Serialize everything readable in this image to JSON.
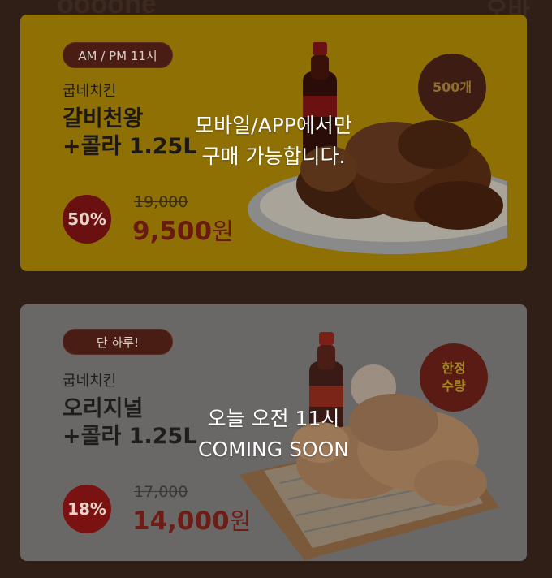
{
  "background": {
    "logo_text_left": "oooone",
    "logo_text_right": "오바오"
  },
  "deals": [
    {
      "time_tag": "AM / PM 11시",
      "brand": "굽네치킨",
      "name_line1": "갈비천왕",
      "name_line2": "+콜라 1.25L",
      "discount": "50%",
      "original_price": "19,000",
      "sale_price": "9,500",
      "currency": "원",
      "badge": "500개",
      "overlay_line1": "모바일/APP에서만",
      "overlay_line2": "구매 가능합니다.",
      "status": "app-only",
      "card_color": "#8e7005"
    },
    {
      "time_tag": "단 하루!",
      "brand": "굽네치킨",
      "name_line1": "오리지널",
      "name_line2": "+콜라 1.25L",
      "discount": "18%",
      "original_price": "17,000",
      "sale_price": "14,000",
      "currency": "원",
      "badge_line1": "한정",
      "badge_line2": "수량",
      "overlay_line1": "오늘 오전 11시",
      "overlay_line2": "COMING SOON",
      "status": "coming-soon",
      "card_color": "#6a6867"
    }
  ]
}
